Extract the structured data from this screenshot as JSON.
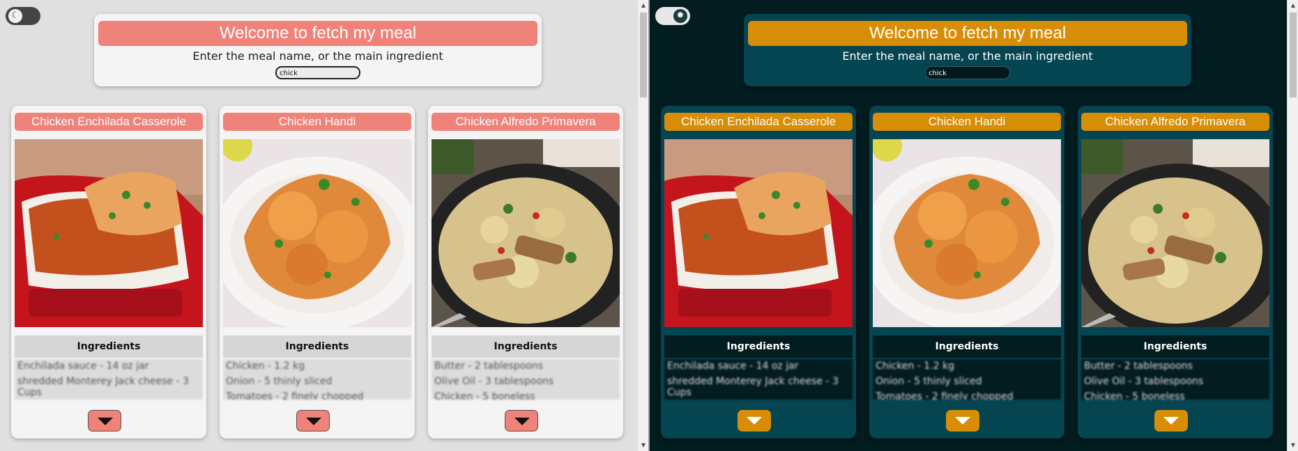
{
  "theme_toggle": {
    "light_icon": "moon-icon",
    "dark_icon": "sun-icon"
  },
  "header": {
    "title": "Welcome to fetch my meal",
    "subtitle": "Enter the meal name, or the main ingredient"
  },
  "search": {
    "light_value": "chick",
    "dark_value": "chick"
  },
  "ingredients_heading": "Ingredients",
  "meals": [
    {
      "name": "Chicken Enchilada Casserole",
      "image": "enchilada-casserole-photo",
      "ingredients": [
        "Enchilada sauce - 14 oz jar",
        "shredded Monterey Jack cheese - 3 Cups"
      ]
    },
    {
      "name": "Chicken Handi",
      "image": "chicken-handi-photo",
      "ingredients": [
        "Chicken - 1.2 kg",
        "Onion - 5 thinly sliced",
        "Tomatoes - 2 finely chopped"
      ]
    },
    {
      "name": "Chicken Alfredo Primavera",
      "image": "alfredo-primavera-photo",
      "ingredients": [
        "Butter - 2 tablespoons",
        "Olive Oil - 3 tablespoons",
        "Chicken - 5 boneless"
      ]
    }
  ],
  "colors": {
    "light_accent": "#ef8279",
    "dark_accent": "#d88d07",
    "light_background": "#e0e0e0",
    "dark_background": "#031c20",
    "dark_panel": "#054552"
  },
  "expand_icon": "caret-down-icon"
}
